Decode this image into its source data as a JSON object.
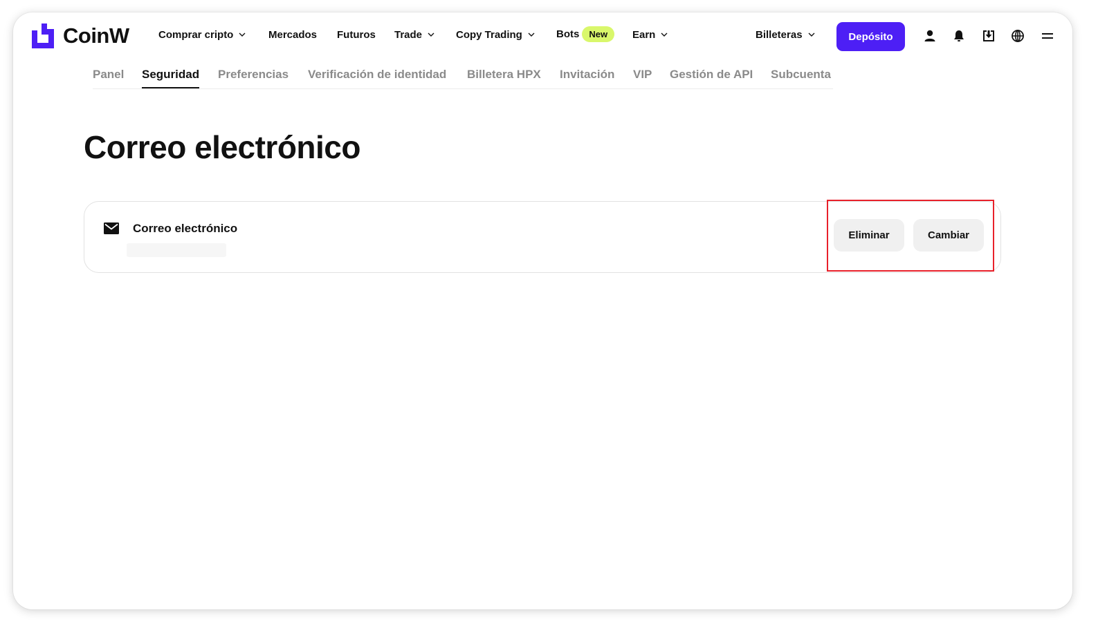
{
  "brand": {
    "name": "CoinW",
    "accent": "#4d1ff5"
  },
  "nav": {
    "items": [
      {
        "label": "Comprar cripto",
        "dropdown": true
      },
      {
        "label": "Mercados",
        "dropdown": false
      },
      {
        "label": "Futuros",
        "dropdown": false
      },
      {
        "label": "Trade",
        "dropdown": true
      },
      {
        "label": "Copy Trading",
        "dropdown": true
      },
      {
        "label": "Bots",
        "dropdown": false,
        "badge": "New",
        "badge_color": "#d9f76b"
      },
      {
        "label": "Earn",
        "dropdown": true
      }
    ],
    "wallets_label": "Billeteras",
    "deposit_label": "Depósito",
    "icons": [
      "user-icon",
      "bell-icon",
      "download-icon",
      "globe-icon",
      "menu-icon"
    ]
  },
  "subtabs": {
    "items": [
      "Panel",
      "Seguridad",
      "Preferencias",
      "Verificación de identidad",
      "Billetera HPX",
      "Invitación",
      "VIP",
      "Gestión de API",
      "Subcuenta"
    ],
    "active": "Seguridad"
  },
  "page": {
    "title": "Correo electrónico"
  },
  "email_card": {
    "icon": "mail-icon",
    "label": "Correo electrónico",
    "delete_label": "Eliminar",
    "change_label": "Cambiar"
  },
  "annotation": {
    "highlight_color": "#e8202a"
  }
}
